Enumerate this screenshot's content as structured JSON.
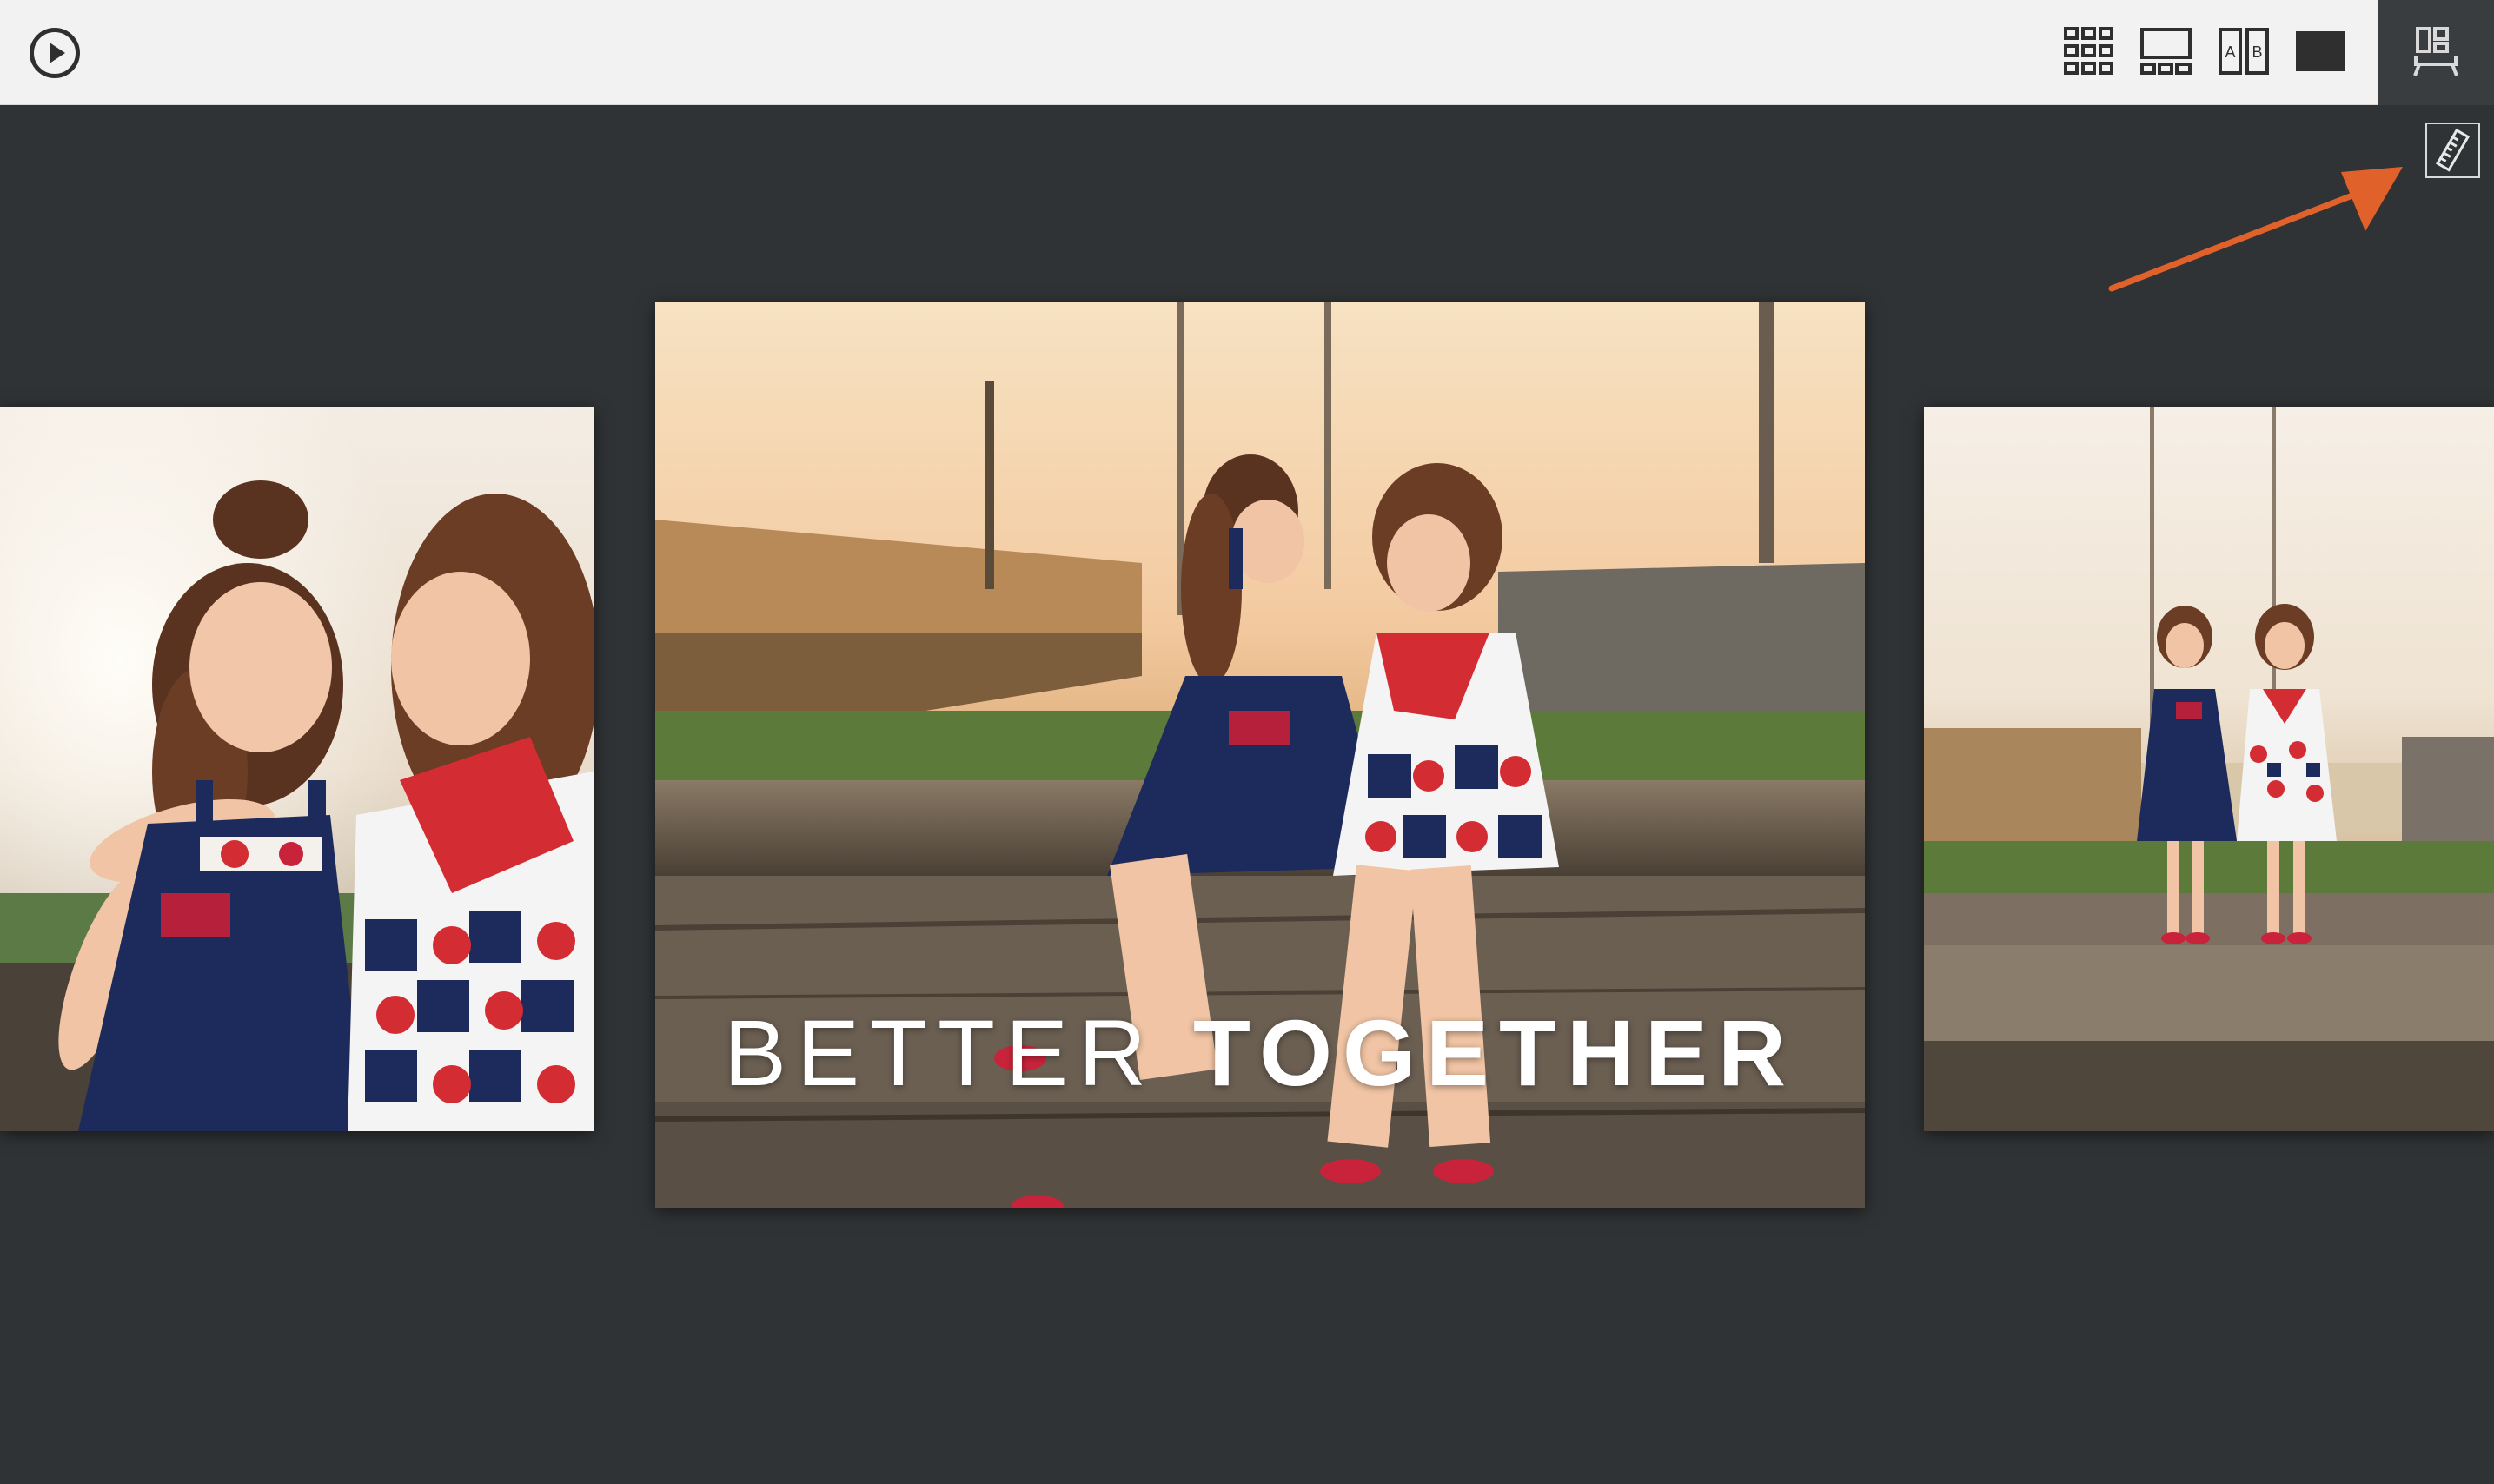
{
  "toolbar": {
    "play_icon": "play-circle-icon",
    "view_modes": [
      {
        "name": "grid-view",
        "icon": "grid-icon"
      },
      {
        "name": "loupe-view",
        "icon": "loupe-icon"
      },
      {
        "name": "compare-view",
        "icon": "compare-ab-icon",
        "label_a": "A",
        "label_b": "B"
      },
      {
        "name": "survey-view",
        "icon": "black-square-icon"
      },
      {
        "name": "layout-view",
        "icon": "layout-board-icon",
        "active": true
      }
    ]
  },
  "ruler_tool": {
    "icon": "ruler-icon"
  },
  "slideshow": {
    "caption_light": "BETTER ",
    "caption_bold": "TOGETHER"
  },
  "colors": {
    "background": "#303335",
    "toolbar": "#f2f2f2",
    "active_tool": "#3a3d40",
    "arrow": "#e0622a"
  }
}
